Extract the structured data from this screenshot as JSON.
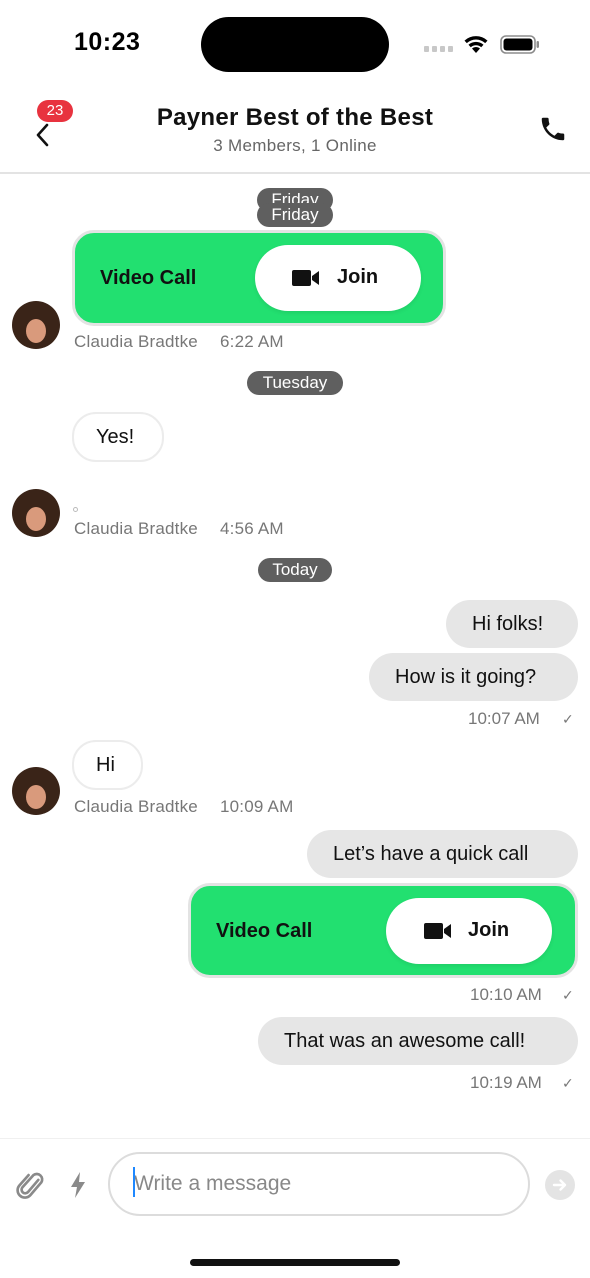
{
  "status": {
    "time": "10:23"
  },
  "header": {
    "badge": "23",
    "title": "Payner Best of the Best",
    "subtitle": "3 Members, 1 Online"
  },
  "chat": {
    "day_friday": "Friday",
    "video_call_1": {
      "label": "Video Call",
      "join": "Join"
    },
    "meta_1": {
      "sender": "Claudia Bradtke",
      "time": "6:22 AM"
    },
    "day_tuesday": "Tuesday",
    "msg_yes": "Yes!",
    "meta_2": {
      "sender": "Claudia Bradtke",
      "time": "4:56 AM"
    },
    "day_today": "Today",
    "msg_hi_folks": "Hi folks!",
    "msg_how": "How is it going?",
    "time_out_1": "10:07 AM",
    "msg_hi": "Hi",
    "meta_3": {
      "sender": "Claudia Bradtke",
      "time": "10:09 AM"
    },
    "msg_quick_call": "Let’s have a quick call",
    "video_call_2": {
      "label": "Video Call",
      "join": "Join"
    },
    "time_out_2": "10:10 AM",
    "msg_awesome": "That was an awesome call!",
    "time_out_3": "10:19 AM",
    "check": "✓"
  },
  "composer": {
    "placeholder": "Write a message",
    "value": ""
  },
  "colors": {
    "video_green": "#22e070",
    "badge_red": "#e8333f",
    "outgoing_bubble": "#e6e6e6",
    "date_chip": "#5f5f5f"
  }
}
